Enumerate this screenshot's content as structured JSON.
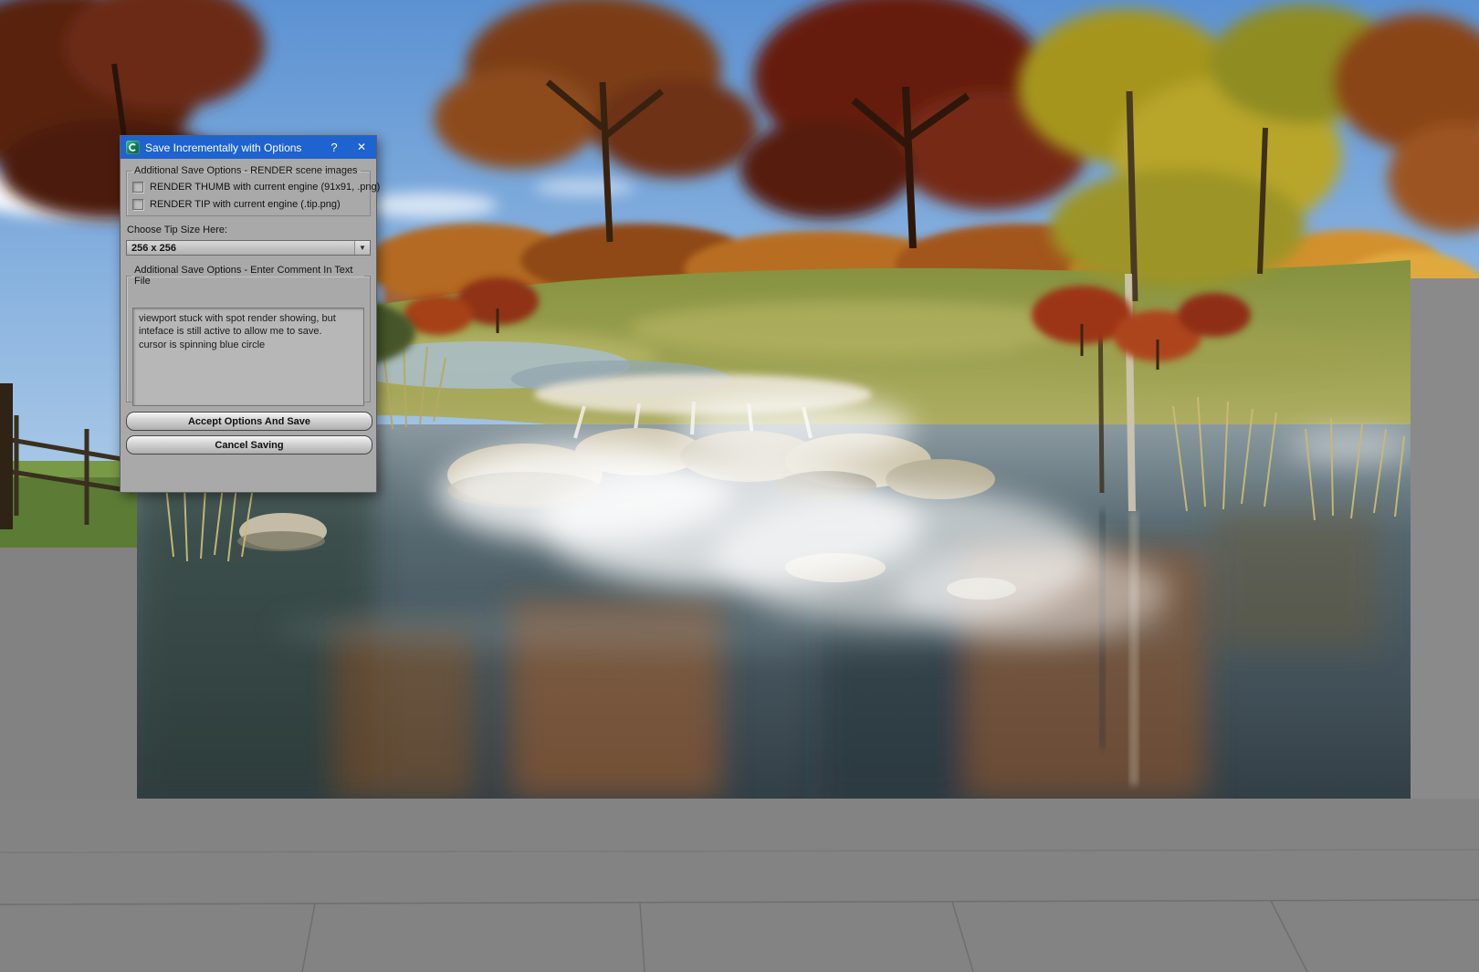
{
  "colors": {
    "titlebar_bg": "#1e63d0",
    "dialog_bg": "#a9a9a9"
  },
  "dialog": {
    "title": "Save Incrementally with Options",
    "help_label": "?",
    "close_label": "✕",
    "render_group": {
      "label": "Additional Save Options - RENDER scene images",
      "thumb_checkbox_label": "RENDER THUMB with current engine (91x91, .png)",
      "tip_checkbox_label": "RENDER TIP with current engine (.tip.png)"
    },
    "tip_size": {
      "label": "Choose Tip Size Here:",
      "value": "256 x 256",
      "dropdown_arrow": "▼"
    },
    "comment_group": {
      "label": "Additional Save Options - Enter Comment In Text File",
      "text": "viewport stuck with spot render showing, but\ninteface is still active to allow me to save.\ncursor is spinning blue circle"
    },
    "buttons": {
      "accept": "Accept Options And Save",
      "cancel": "Cancel Saving"
    }
  }
}
